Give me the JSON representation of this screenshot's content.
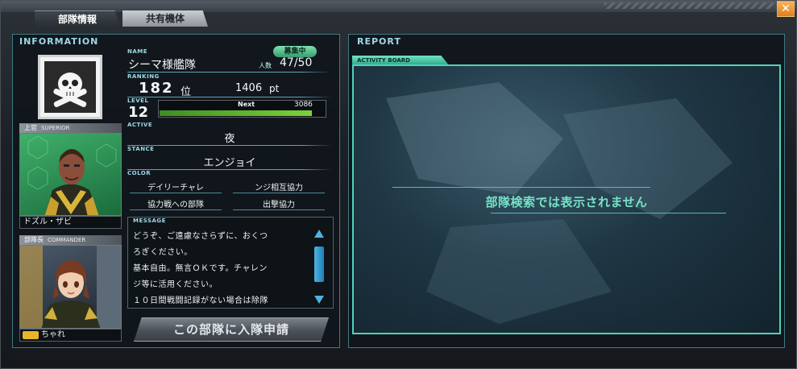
{
  "tabs": [
    {
      "label": "部隊情報",
      "active": true
    },
    {
      "label": "共有機体",
      "active": false
    }
  ],
  "info": {
    "title": "INFORMATION",
    "name_label": "NAME",
    "name": "シーマ様艦隊",
    "recruit_badge": "募集中",
    "members_label": "人数",
    "members": "47/50",
    "ranking_label": "RANKING",
    "rank": "182",
    "rank_unit": "位",
    "points": "1406",
    "points_unit": "pt",
    "level_label": "LEVEL",
    "level": "12",
    "next_label": "Next",
    "next_value": "3086",
    "exp_progress_percent": 92,
    "active_label": "ACTIVE",
    "active": "夜",
    "stance_label": "STANCE",
    "stance": "エンジョイ",
    "color_label": "COLOR",
    "colors": [
      "デイリーチャレ",
      "ンジ相互協力",
      "協力戦への部隊",
      "出撃協力"
    ],
    "message_label": "MESSAGE",
    "message_lines": [
      "どうぞ、ご遠慮なさらずに、おくつ",
      "ろぎください。",
      "基本自由。無言ＯＫです。チャレン",
      "ジ等に活用ください。",
      "１０日間戦闘記録がない場合は除隊"
    ],
    "apply_button": "この部隊に入隊申請"
  },
  "superior": {
    "header_jp": "上官",
    "header_en": "SUPERIOR",
    "name": "ドズル・ザビ"
  },
  "commander": {
    "header_jp": "部隊長",
    "header_en": "COMMANDER",
    "name": "ちゃれ"
  },
  "report": {
    "title": "REPORT",
    "board_tab": "ACTIVITY BOARD",
    "board_message": "部隊検索では表示されません"
  },
  "colors": {
    "accent": "#9fd8e4",
    "board": "#4fd3b6",
    "exp": "#7bd23a",
    "close": "#e07f1c"
  },
  "icons": {
    "emblem": "skull-crossbones-icon",
    "close": "close-icon",
    "scroll_up": "triangle-up-icon",
    "scroll_down": "triangle-down-icon",
    "commander_badge": "rank-badge-icon"
  }
}
